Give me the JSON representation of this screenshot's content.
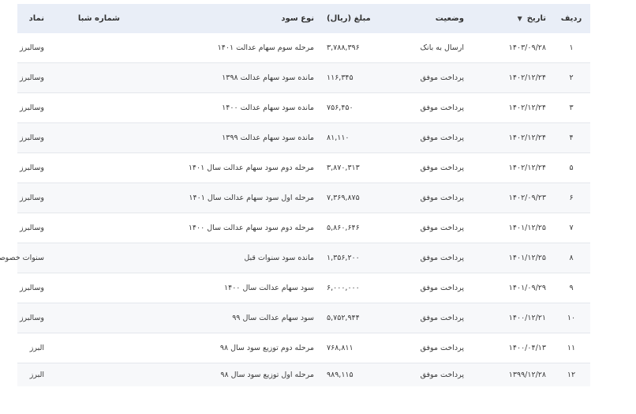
{
  "table": {
    "headers": {
      "row": "ردیف",
      "date": "تاریخ",
      "status": "وضعیت",
      "amount": "مبلغ (ریال)",
      "type": "نوع سود",
      "shaba": "شماره شبا",
      "symbol": "نماد"
    },
    "sort_icon": "▼",
    "rows": [
      {
        "row": "۱",
        "date": "۱۴۰۳/۰۹/۲۸",
        "status": "ارسال به بانک",
        "amount": "۳,۷۸۸,۳۹۶",
        "type": "مرحله سوم سهام عدالت ۱۴۰۱",
        "shaba": "",
        "symbol": "وسالبرز"
      },
      {
        "row": "۲",
        "date": "۱۴۰۲/۱۲/۲۴",
        "status": "پرداخت موفق",
        "amount": "۱۱۶,۳۴۵",
        "type": "مانده سود سهام عدالت ۱۳۹۸",
        "shaba": "",
        "symbol": "وسالبرز"
      },
      {
        "row": "۳",
        "date": "۱۴۰۲/۱۲/۲۴",
        "status": "پرداخت موفق",
        "amount": "۷۵۶,۴۵۰",
        "type": "مانده سود سهام عدالت ۱۴۰۰",
        "shaba": "",
        "symbol": "وسالبرز"
      },
      {
        "row": "۴",
        "date": "۱۴۰۲/۱۲/۲۴",
        "status": "پرداخت موفق",
        "amount": "۸۱,۱۱۰",
        "type": "مانده سود سهام عدالت ۱۳۹۹",
        "shaba": "",
        "symbol": "وسالبرز"
      },
      {
        "row": "۵",
        "date": "۱۴۰۲/۱۲/۲۴",
        "status": "پرداخت موفق",
        "amount": "۳,۸۷۰,۳۱۳",
        "type": "مرحله دوم سود سهام عدالت سال ۱۴۰۱",
        "shaba": "",
        "symbol": "وسالبرز"
      },
      {
        "row": "۶",
        "date": "۱۴۰۲/۰۹/۲۳",
        "status": "پرداخت موفق",
        "amount": "۷,۳۶۹,۸۷۵",
        "type": "مرحله اول سود سهام عدالت سال ۱۴۰۱",
        "shaba": "",
        "symbol": "وسالبرز"
      },
      {
        "row": "۷",
        "date": "۱۴۰۱/۱۲/۲۵",
        "status": "پرداخت موفق",
        "amount": "۵,۸۶۰,۶۴۶",
        "type": "مرحله دوم سود سهام عدالت سال ۱۴۰۰",
        "shaba": "",
        "symbol": "وسالبرز"
      },
      {
        "row": "۸",
        "date": "۱۴۰۱/۱۲/۲۵",
        "status": "پرداخت موفق",
        "amount": "۱,۳۵۶,۲۰۰",
        "type": "مانده سود سنوات قبل",
        "shaba": "",
        "symbol": "سنوات خصوصی سازی"
      },
      {
        "row": "۹",
        "date": "۱۴۰۱/۰۹/۲۹",
        "status": "پرداخت موفق",
        "amount": "۶,۰۰۰,۰۰۰",
        "type": "سود سهام عدالت سال ۱۴۰۰",
        "shaba": "",
        "symbol": "وسالبرز"
      },
      {
        "row": "۱۰",
        "date": "۱۴۰۰/۱۲/۲۱",
        "status": "پرداخت موفق",
        "amount": "۵,۷۵۲,۹۴۴",
        "type": "سود سهام عدالت سال ۹۹",
        "shaba": "",
        "symbol": "وسالبرز"
      },
      {
        "row": "۱۱",
        "date": "۱۴۰۰/۰۴/۱۳",
        "status": "پرداخت موفق",
        "amount": "۷۶۸,۸۱۱",
        "type": "مرحله دوم توزیع سود سال ۹۸",
        "shaba": "",
        "symbol": "البرز"
      },
      {
        "row": "۱۲",
        "date": "۱۳۹۹/۱۲/۲۸",
        "status": "پرداخت موفق",
        "amount": "۹۸۹,۱۱۵",
        "type": "مرحله اول توزیع سود سال ۹۸",
        "shaba": "",
        "symbol": "البرز"
      }
    ]
  }
}
